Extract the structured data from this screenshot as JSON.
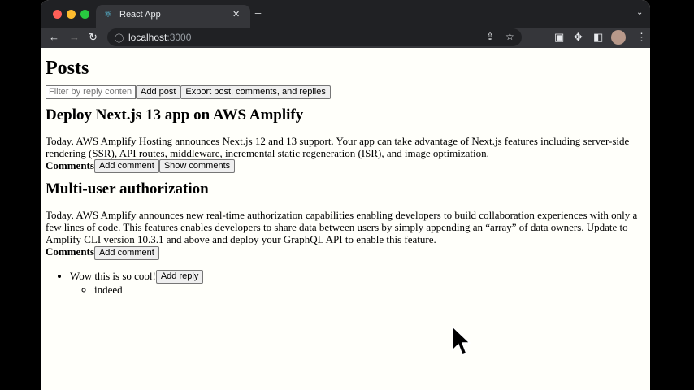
{
  "browser": {
    "tab_title": "React App",
    "url_host": "localhost",
    "url_port": ":3000"
  },
  "page": {
    "title": "Posts",
    "filter_placeholder": "Filter by reply content",
    "add_post": "Add post",
    "export": "Export post, comments, and replies"
  },
  "posts": [
    {
      "title": "Deploy Next.js 13 app on AWS Amplify",
      "body": "Today, AWS Amplify Hosting announces Next.js 12 and 13 support. Your app can take advantage of Next.js features including server-side rendering (SSR), API routes, middleware, incremental static regeneration (ISR), and image optimization.",
      "comments_label": "Comments",
      "add_comment": "Add comment",
      "show_comments": "Show comments"
    },
    {
      "title": "Multi-user authorization",
      "body": "Today, AWS Amplify announces new real-time authorization capabilities enabling developers to build collaboration experiences with only a few lines of code. This features enables developers to share data between users by simply appending an “array” of data owners. Update to Amplify CLI version 10.3.1 and above and deploy your GraphQL API to enable this feature.",
      "comments_label": "Comments",
      "add_comment": "Add comment",
      "comments": [
        {
          "text": "Wow this is so cool!",
          "add_reply": "Add reply",
          "replies": [
            "indeed"
          ]
        }
      ]
    }
  ]
}
